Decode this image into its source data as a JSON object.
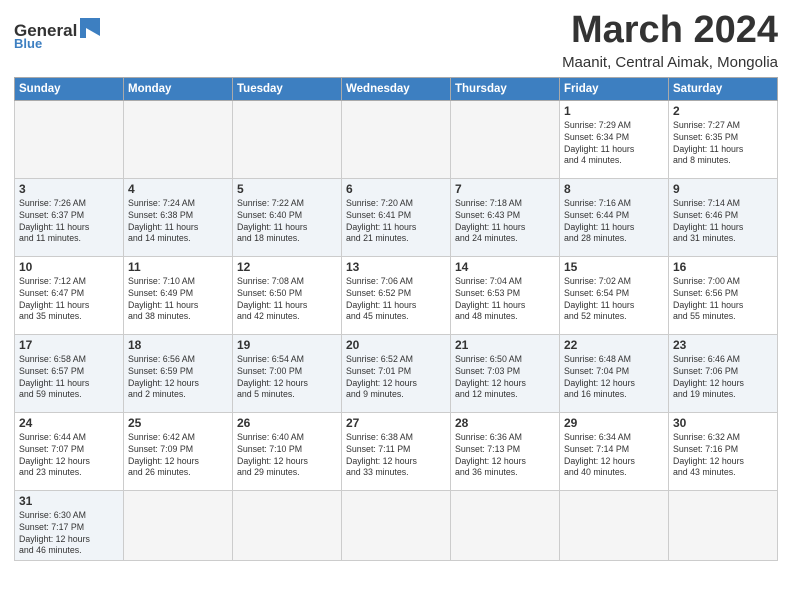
{
  "logo": {
    "text_general": "General",
    "text_blue": "Blue"
  },
  "title": {
    "month": "March 2024",
    "location": "Maanit, Central Aimak, Mongolia"
  },
  "weekdays": [
    "Sunday",
    "Monday",
    "Tuesday",
    "Wednesday",
    "Thursday",
    "Friday",
    "Saturday"
  ],
  "weeks": [
    [
      {
        "day": "",
        "info": "",
        "empty": true
      },
      {
        "day": "",
        "info": "",
        "empty": true
      },
      {
        "day": "",
        "info": "",
        "empty": true
      },
      {
        "day": "",
        "info": "",
        "empty": true
      },
      {
        "day": "",
        "info": "",
        "empty": true
      },
      {
        "day": "1",
        "info": "Sunrise: 7:29 AM\nSunset: 6:34 PM\nDaylight: 11 hours\nand 4 minutes."
      },
      {
        "day": "2",
        "info": "Sunrise: 7:27 AM\nSunset: 6:35 PM\nDaylight: 11 hours\nand 8 minutes."
      }
    ],
    [
      {
        "day": "3",
        "info": "Sunrise: 7:26 AM\nSunset: 6:37 PM\nDaylight: 11 hours\nand 11 minutes."
      },
      {
        "day": "4",
        "info": "Sunrise: 7:24 AM\nSunset: 6:38 PM\nDaylight: 11 hours\nand 14 minutes."
      },
      {
        "day": "5",
        "info": "Sunrise: 7:22 AM\nSunset: 6:40 PM\nDaylight: 11 hours\nand 18 minutes."
      },
      {
        "day": "6",
        "info": "Sunrise: 7:20 AM\nSunset: 6:41 PM\nDaylight: 11 hours\nand 21 minutes."
      },
      {
        "day": "7",
        "info": "Sunrise: 7:18 AM\nSunset: 6:43 PM\nDaylight: 11 hours\nand 24 minutes."
      },
      {
        "day": "8",
        "info": "Sunrise: 7:16 AM\nSunset: 6:44 PM\nDaylight: 11 hours\nand 28 minutes."
      },
      {
        "day": "9",
        "info": "Sunrise: 7:14 AM\nSunset: 6:46 PM\nDaylight: 11 hours\nand 31 minutes."
      }
    ],
    [
      {
        "day": "10",
        "info": "Sunrise: 7:12 AM\nSunset: 6:47 PM\nDaylight: 11 hours\nand 35 minutes."
      },
      {
        "day": "11",
        "info": "Sunrise: 7:10 AM\nSunset: 6:49 PM\nDaylight: 11 hours\nand 38 minutes."
      },
      {
        "day": "12",
        "info": "Sunrise: 7:08 AM\nSunset: 6:50 PM\nDaylight: 11 hours\nand 42 minutes."
      },
      {
        "day": "13",
        "info": "Sunrise: 7:06 AM\nSunset: 6:52 PM\nDaylight: 11 hours\nand 45 minutes."
      },
      {
        "day": "14",
        "info": "Sunrise: 7:04 AM\nSunset: 6:53 PM\nDaylight: 11 hours\nand 48 minutes."
      },
      {
        "day": "15",
        "info": "Sunrise: 7:02 AM\nSunset: 6:54 PM\nDaylight: 11 hours\nand 52 minutes."
      },
      {
        "day": "16",
        "info": "Sunrise: 7:00 AM\nSunset: 6:56 PM\nDaylight: 11 hours\nand 55 minutes."
      }
    ],
    [
      {
        "day": "17",
        "info": "Sunrise: 6:58 AM\nSunset: 6:57 PM\nDaylight: 11 hours\nand 59 minutes."
      },
      {
        "day": "18",
        "info": "Sunrise: 6:56 AM\nSunset: 6:59 PM\nDaylight: 12 hours\nand 2 minutes."
      },
      {
        "day": "19",
        "info": "Sunrise: 6:54 AM\nSunset: 7:00 PM\nDaylight: 12 hours\nand 5 minutes."
      },
      {
        "day": "20",
        "info": "Sunrise: 6:52 AM\nSunset: 7:01 PM\nDaylight: 12 hours\nand 9 minutes."
      },
      {
        "day": "21",
        "info": "Sunrise: 6:50 AM\nSunset: 7:03 PM\nDaylight: 12 hours\nand 12 minutes."
      },
      {
        "day": "22",
        "info": "Sunrise: 6:48 AM\nSunset: 7:04 PM\nDaylight: 12 hours\nand 16 minutes."
      },
      {
        "day": "23",
        "info": "Sunrise: 6:46 AM\nSunset: 7:06 PM\nDaylight: 12 hours\nand 19 minutes."
      }
    ],
    [
      {
        "day": "24",
        "info": "Sunrise: 6:44 AM\nSunset: 7:07 PM\nDaylight: 12 hours\nand 23 minutes."
      },
      {
        "day": "25",
        "info": "Sunrise: 6:42 AM\nSunset: 7:09 PM\nDaylight: 12 hours\nand 26 minutes."
      },
      {
        "day": "26",
        "info": "Sunrise: 6:40 AM\nSunset: 7:10 PM\nDaylight: 12 hours\nand 29 minutes."
      },
      {
        "day": "27",
        "info": "Sunrise: 6:38 AM\nSunset: 7:11 PM\nDaylight: 12 hours\nand 33 minutes."
      },
      {
        "day": "28",
        "info": "Sunrise: 6:36 AM\nSunset: 7:13 PM\nDaylight: 12 hours\nand 36 minutes."
      },
      {
        "day": "29",
        "info": "Sunrise: 6:34 AM\nSunset: 7:14 PM\nDaylight: 12 hours\nand 40 minutes."
      },
      {
        "day": "30",
        "info": "Sunrise: 6:32 AM\nSunset: 7:16 PM\nDaylight: 12 hours\nand 43 minutes."
      }
    ],
    [
      {
        "day": "31",
        "info": "Sunrise: 6:30 AM\nSunset: 7:17 PM\nDaylight: 12 hours\nand 46 minutes."
      },
      {
        "day": "",
        "info": "",
        "empty": true
      },
      {
        "day": "",
        "info": "",
        "empty": true
      },
      {
        "day": "",
        "info": "",
        "empty": true
      },
      {
        "day": "",
        "info": "",
        "empty": true
      },
      {
        "day": "",
        "info": "",
        "empty": true
      },
      {
        "day": "",
        "info": "",
        "empty": true
      }
    ]
  ]
}
